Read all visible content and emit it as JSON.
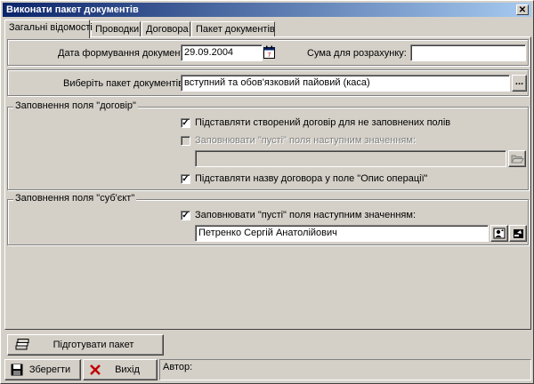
{
  "window": {
    "title": "Виконати пакет документів",
    "close_glyph": "✕"
  },
  "tabs": [
    "Загальні відомості",
    "Проводки",
    "Договора",
    "Пакет документів"
  ],
  "form": {
    "date_label": "Дата формування документів",
    "date_value": "29.09.2004",
    "sum_label": "Сума для розрахунку:",
    "sum_value": "",
    "package_label": "Виберіть пакет документів",
    "package_value": "вступний та обов'язковий пайовий (каса)",
    "ellipsis": "..."
  },
  "group_contract": {
    "title": "Заповнення поля \"договір\"",
    "opt1_label": "Підставляти створений договір для не заповнених полів",
    "opt1_checked": true,
    "opt2_label": "Заповнювати \"пусті\" поля наступним значенням:",
    "opt2_checked": false,
    "opt2_value": "",
    "opt3_label": "Підставляти назву договора у поле \"Опис операції\"",
    "opt3_checked": true
  },
  "group_subject": {
    "title": "Заповнення поля \"суб'єкт\"",
    "opt_label": "Заповнювати \"пусті\" поля наступним значенням:",
    "opt_checked": true,
    "value": "Петренко Сергій Анатолійович"
  },
  "buttons": {
    "prepare": "Підготувати пакет",
    "save": "Зберегти",
    "exit": "Вихід"
  },
  "status": {
    "author_label": "Автор:"
  },
  "icons": [
    "calendar-icon",
    "folder-open-icon",
    "person-search-icon",
    "open-card-icon",
    "stack-icon",
    "floppy-disk-icon",
    "red-x-icon"
  ]
}
